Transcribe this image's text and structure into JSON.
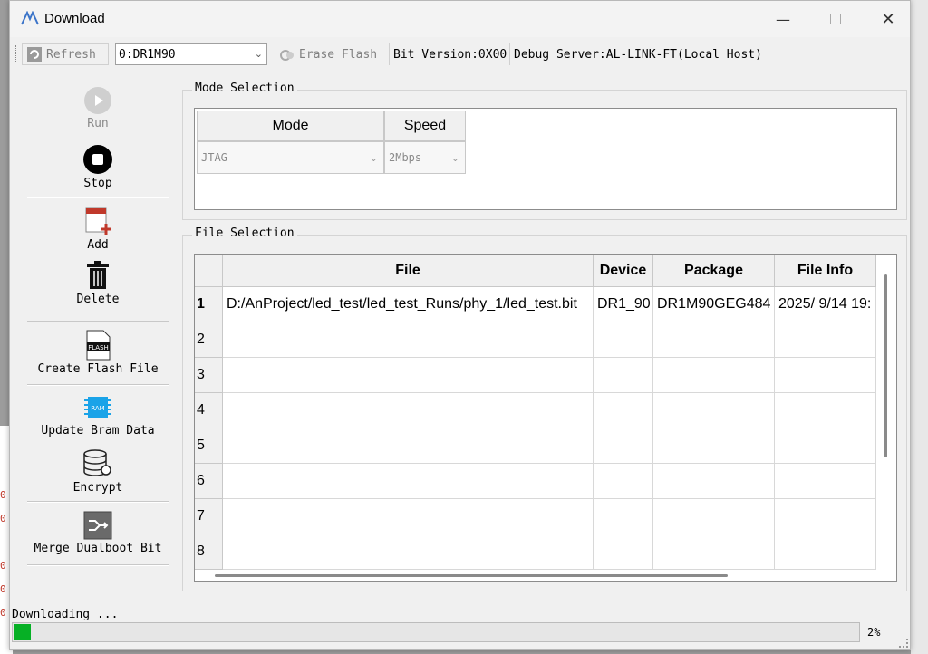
{
  "window": {
    "title": "Download"
  },
  "toolbar": {
    "refresh_label": "Refresh",
    "device_selected": "0:DR1M90",
    "erase_label": "Erase Flash",
    "bit_version": "Bit Version:0X00",
    "debug_server": "Debug Server:AL-LINK-FT(Local Host)"
  },
  "sidebar": {
    "run": "Run",
    "stop": "Stop",
    "add": "Add",
    "delete": "Delete",
    "create_flash": "Create Flash File",
    "flash_icon_text": "FLASH",
    "update_bram": "Update Bram Data",
    "ram_icon_text": "RAM",
    "encrypt": "Encrypt",
    "merge": "Merge Dualboot Bit"
  },
  "mode_selection": {
    "title": "Mode Selection",
    "headers": [
      "Mode",
      "Speed"
    ],
    "mode_value": "JTAG",
    "speed_value": "2Mbps"
  },
  "file_selection": {
    "title": "File Selection",
    "headers": [
      "File",
      "Device",
      "Package",
      "File Info"
    ],
    "rows": [
      {
        "num": "1",
        "file": "D:/AnProject/led_test/led_test_Runs/phy_1/led_test.bit",
        "device": "DR1_90",
        "package": "DR1M90GEG484",
        "info": "2025/ 9/14 19:"
      },
      {
        "num": "2",
        "file": "",
        "device": "",
        "package": "",
        "info": ""
      },
      {
        "num": "3",
        "file": "",
        "device": "",
        "package": "",
        "info": ""
      },
      {
        "num": "4",
        "file": "",
        "device": "",
        "package": "",
        "info": ""
      },
      {
        "num": "5",
        "file": "",
        "device": "",
        "package": "",
        "info": ""
      },
      {
        "num": "6",
        "file": "",
        "device": "",
        "package": "",
        "info": ""
      },
      {
        "num": "7",
        "file": "",
        "device": "",
        "package": "",
        "info": ""
      },
      {
        "num": "8",
        "file": "",
        "device": "",
        "package": "",
        "info": ""
      }
    ]
  },
  "status": {
    "text": "Downloading ...",
    "progress_fraction": 0.02,
    "percent_label": "2%"
  },
  "colors": {
    "progress": "#06b025",
    "stop_icon": "#000000",
    "add_accent": "#c0392b",
    "ram_icon": "#1aa3e8"
  }
}
